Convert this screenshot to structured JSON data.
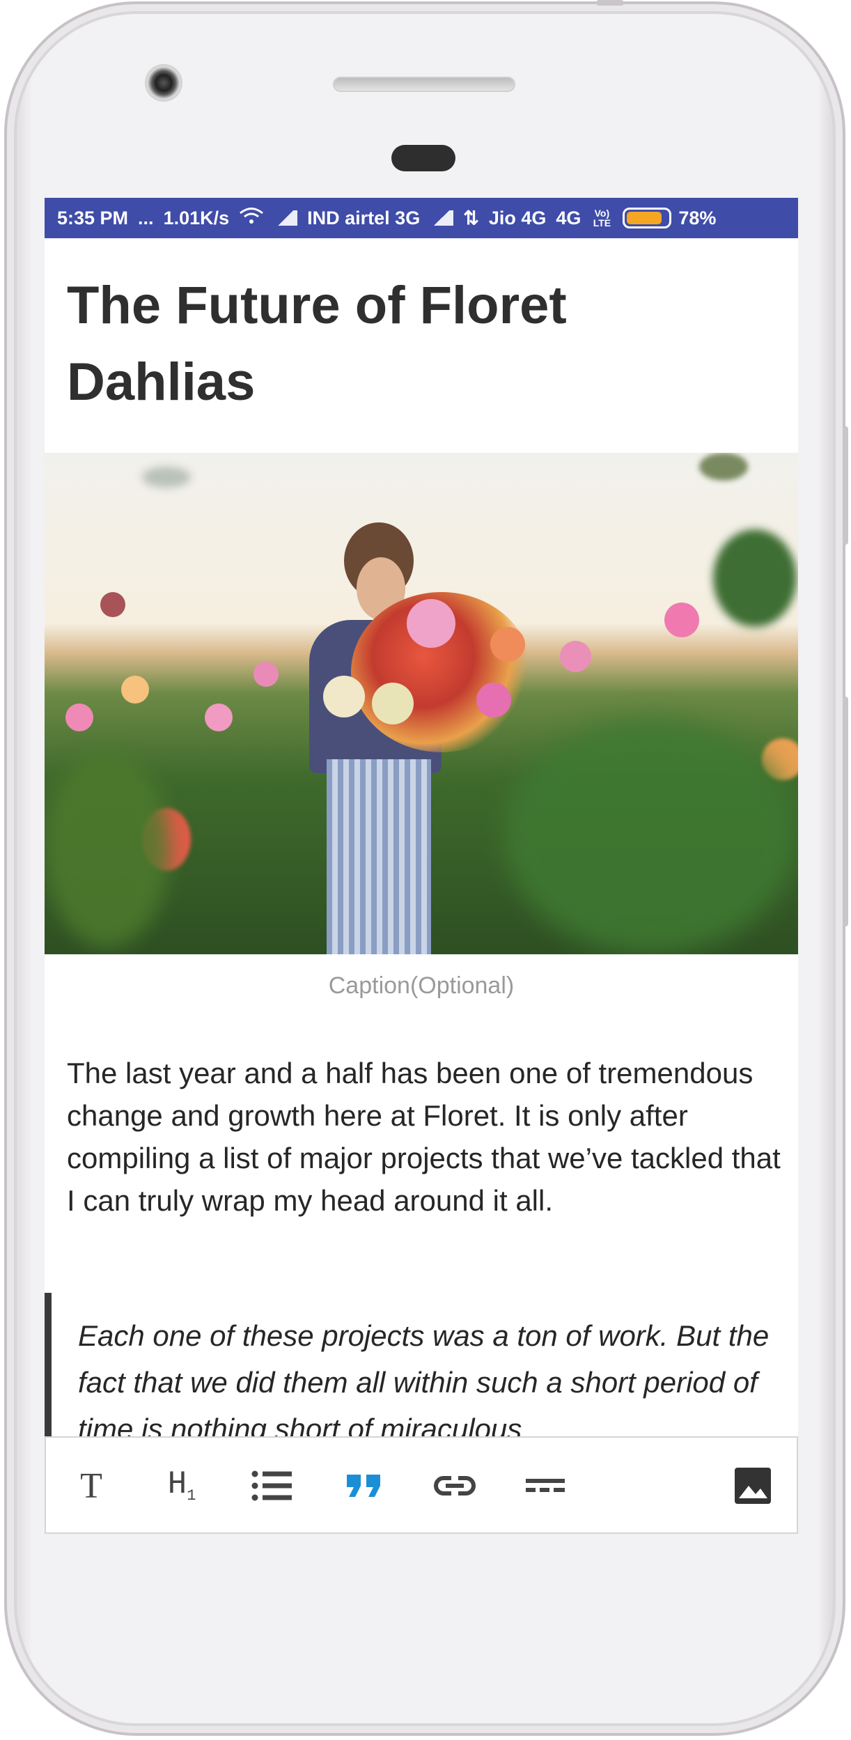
{
  "status_bar": {
    "time": "5:35 PM",
    "dots": "...",
    "speed": "1.01K/s",
    "carrier1": "IND airtel 3G",
    "carrier2": "Jio 4G",
    "network": "4G",
    "volte": "Vo) LTE",
    "battery": "78%"
  },
  "article": {
    "title": "The Future of Floret Dahlias",
    "caption_placeholder": "Caption(Optional)",
    "paragraph": "The last year and a half has been one of tremendous change and growth here at Floret. It is only after compiling a list of major projects that we’ve tackled that I can truly wrap my head around it all.",
    "quote": "Each one of these projects was a ton of work. But the fact that we did them all within such a short period of time is nothing short of miraculous"
  },
  "toolbar": {
    "text_label": "T",
    "heading_label": "H",
    "heading_sub": "1"
  },
  "colors": {
    "status_bar": "#3f4ca8",
    "quote_active": "#1a8fd6",
    "battery": "#f5a623"
  },
  "icons": [
    "text-icon",
    "heading-icon",
    "list-icon",
    "quote-icon",
    "link-icon",
    "divider-icon",
    "image-icon"
  ]
}
